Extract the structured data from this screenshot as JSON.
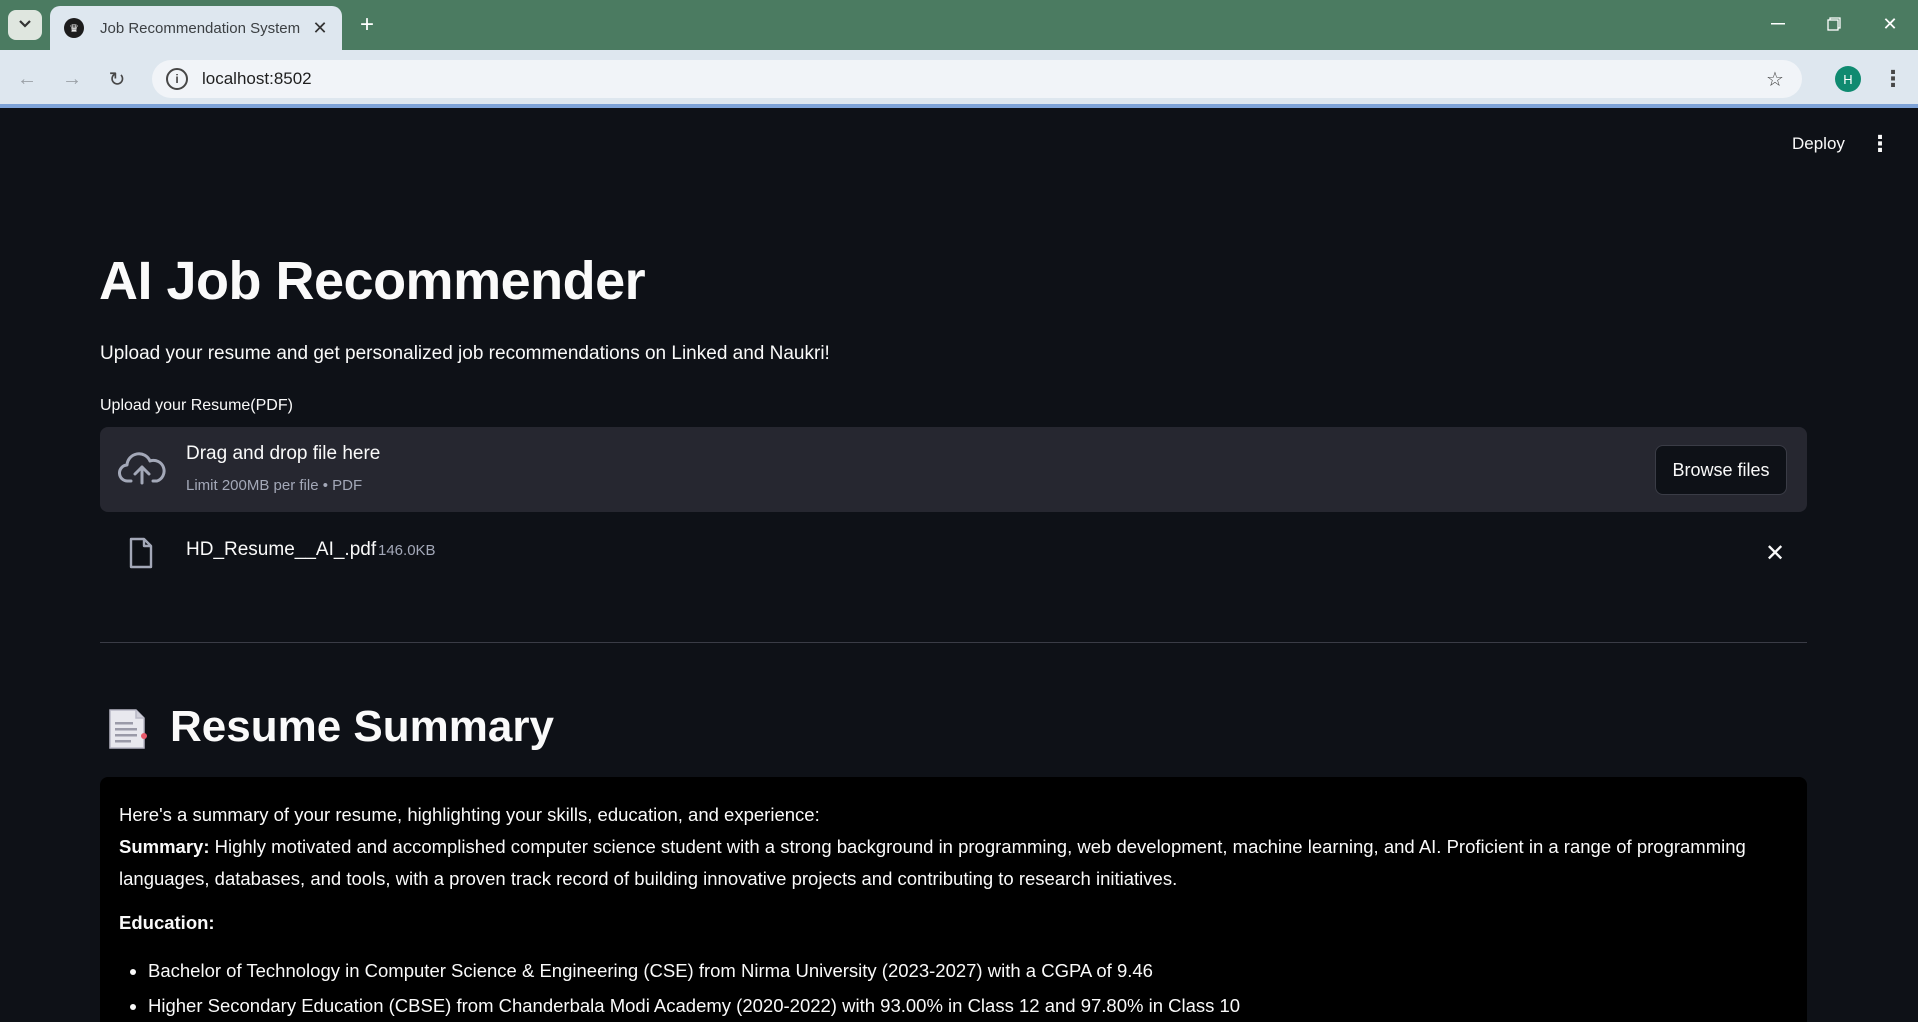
{
  "browser": {
    "tab_title": "Job Recommendation System",
    "url": "localhost:8502",
    "profile_initial": "H"
  },
  "app": {
    "deploy_label": "Deploy",
    "title": "AI Job Recommender",
    "subtitle": "Upload your resume and get personalized job recommendations on Linked and Naukri!",
    "upload_label": "Upload your Resume(PDF)",
    "dropzone": {
      "main_text": "Drag and drop file here",
      "limit_text": "Limit 200MB per file • PDF",
      "browse_label": "Browse files"
    },
    "uploaded_file": {
      "name": "HD_Resume__AI_.pdf",
      "size": "146.0KB"
    },
    "summary_section": {
      "title": "Resume Summary",
      "intro": "Here's a summary of your resume, highlighting your skills, education, and experience:",
      "summary_label": "Summary:",
      "summary_text": " Highly motivated and accomplished computer science student with a strong background in programming, web development, machine learning, and AI. Proficient in a range of programming languages, databases, and tools, with a proven track record of building innovative projects and contributing to research initiatives.",
      "education_label": "Education:",
      "education_items": [
        "Bachelor of Technology in Computer Science & Engineering (CSE) from Nirma University (2023-2027) with a CGPA of 9.46",
        "Higher Secondary Education (CBSE) from Chanderbala Modi Academy (2020-2022) with 93.00% in Class 12 and 97.80% in Class 10"
      ]
    }
  },
  "colors": {
    "app_background": "#0e1117",
    "dropzone_background": "#262730",
    "summary_background": "#000000",
    "muted_text": "#a3a8b8",
    "tabbar": "#4b7b61"
  },
  "icons": [
    "chevron-down-icon",
    "crown-icon",
    "close-icon",
    "plus-icon",
    "minimize-icon",
    "restore-icon",
    "back-icon",
    "forward-icon",
    "reload-icon",
    "info-icon",
    "star-icon",
    "kebab-icon",
    "cloud-upload-icon",
    "file-icon",
    "document-emoji-icon"
  ]
}
